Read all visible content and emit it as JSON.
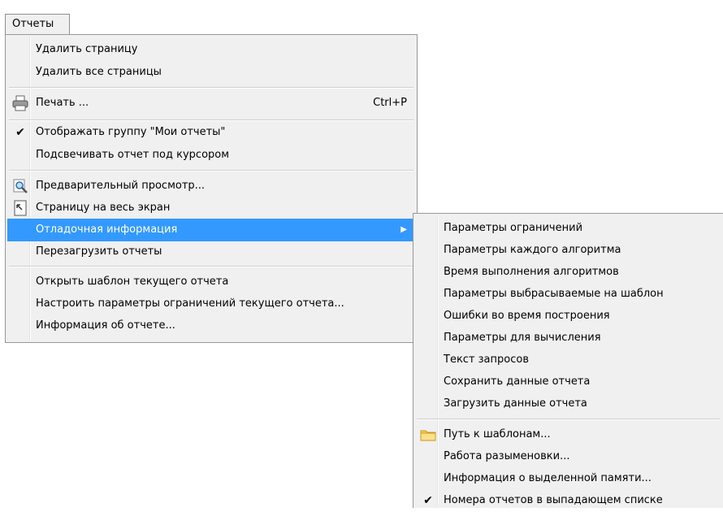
{
  "menubar": {
    "reports": "Отчеты"
  },
  "main_menu": {
    "delete_page": "Удалить страницу",
    "delete_all_pages": "Удалить все страницы",
    "print": "Печать ...",
    "print_shortcut": "Ctrl+P",
    "show_my_reports_group": "Отображать группу \"Мои отчеты\"",
    "highlight_report_under_cursor": "Подсвечивать отчет под курсором",
    "preview": "Предварительный просмотр...",
    "page_full_screen": "Страницу на весь экран",
    "debug_info": "Отладочная информация",
    "reload_reports": "Перезагрузить отчеты",
    "open_current_template": "Открыть шаблон текущего отчета",
    "configure_restriction_params": "Настроить параметры ограничений текущего отчета...",
    "report_info": "Информация об отчете..."
  },
  "sub_menu": {
    "restriction_params": "Параметры ограничений",
    "each_algorithm_params": "Параметры каждого алгоритма",
    "algorithms_exec_time": "Время выполнения алгоритмов",
    "params_thrown_to_template": "Параметры выбрасываемые на шаблон",
    "build_errors": "Ошибки во время построения",
    "calc_params": "Параметры для вычисления",
    "query_text": "Текст запросов",
    "save_report_data": "Сохранить данные отчета",
    "load_report_data": "Загрузить данные отчета",
    "template_path": "Путь к шаблонам...",
    "dereference_work": "Работа разыменовки...",
    "allocated_memory_info": "Информация о выделенной памяти...",
    "report_numbers_in_dropdown": "Номера отчетов в выпадающем списке"
  },
  "colors": {
    "highlight": "#3399ff",
    "menu_bg": "#f0f0f0"
  },
  "icons": [
    "printer-icon",
    "check-icon",
    "magnifier-preview-icon",
    "page-fullscreen-icon",
    "submenu-arrow-icon",
    "folder-icon"
  ]
}
